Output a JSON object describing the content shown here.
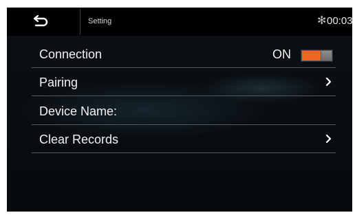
{
  "header": {
    "title": "Setting",
    "back_icon": "back-arrow-icon",
    "bluetooth_icon": "✻",
    "clock": "00:03"
  },
  "items": [
    {
      "label": "Connection",
      "value": "ON",
      "toggle_on": true,
      "accent": "#f26522"
    },
    {
      "label": "Pairing",
      "icon": "chevron-right-icon"
    },
    {
      "label": "Device Name:"
    },
    {
      "label": "Clear Records",
      "icon": "chevron-right-icon"
    }
  ]
}
